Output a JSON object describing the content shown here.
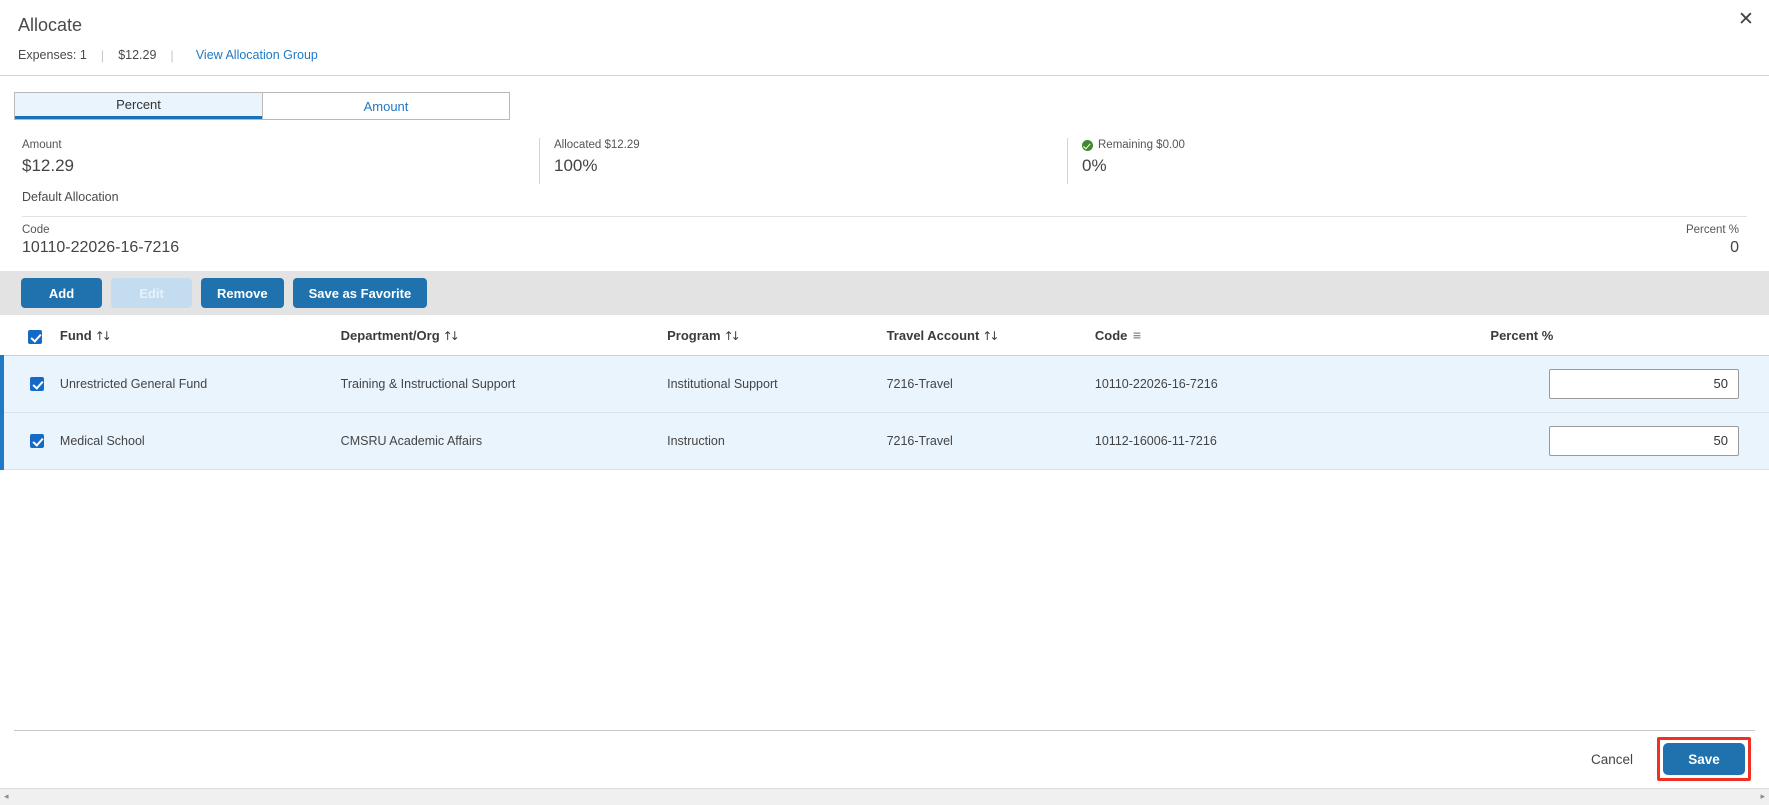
{
  "header": {
    "title": "Allocate",
    "expenses_label": "Expenses: 1",
    "amount_label": "$12.29",
    "view_group_link": "View Allocation Group",
    "separator": "|",
    "close_icon": "✕"
  },
  "toggle": {
    "percent_label": "Percent",
    "amount_label": "Amount",
    "active": "Percent"
  },
  "summary": {
    "amount": {
      "label": "Amount",
      "value": "$12.29"
    },
    "allocated": {
      "label": "Allocated $12.29",
      "value": "100%"
    },
    "remaining": {
      "label": "Remaining $0.00",
      "value": "0%",
      "status_color": "#3f8a2e"
    }
  },
  "default_allocation": {
    "heading": "Default Allocation",
    "code_label": "Code",
    "code_value": "10110-22026-16-7216",
    "percent_label": "Percent %",
    "percent_value": "0"
  },
  "actions": {
    "add": "Add",
    "edit": "Edit",
    "remove": "Remove",
    "save_as_favorite": "Save as Favorite"
  },
  "table": {
    "sort_icon": "↑↓",
    "sort_active_icon": "≡",
    "columns": [
      {
        "key": "fund",
        "label": "Fund"
      },
      {
        "key": "dept",
        "label": "Department/Org"
      },
      {
        "key": "program",
        "label": "Program"
      },
      {
        "key": "travel_account",
        "label": "Travel Account"
      },
      {
        "key": "code",
        "label": "Code"
      },
      {
        "key": "percent",
        "label": "Percent %"
      }
    ],
    "rows": [
      {
        "selected": true,
        "fund": "Unrestricted General Fund",
        "dept": "Training & Instructional Support",
        "program": "Institutional Support",
        "travel_account": "7216-Travel",
        "code": "10110-22026-16-7216",
        "percent": "50"
      },
      {
        "selected": true,
        "fund": "Medical School",
        "dept": "CMSRU Academic Affairs",
        "program": "Instruction",
        "travel_account": "7216-Travel",
        "code": "10112-16006-11-7216",
        "percent": "50"
      }
    ]
  },
  "footer": {
    "cancel": "Cancel",
    "save": "Save",
    "save_highlight_color": "#ee3124"
  },
  "scrollbar": {
    "left_arrow": "◂",
    "right_arrow": "▸"
  },
  "colors": {
    "primary_blue": "#1f72ad",
    "link_blue": "#1f79c4",
    "row_blue": "#e9f4fd",
    "toolbar_gray": "#e3e3e3"
  }
}
